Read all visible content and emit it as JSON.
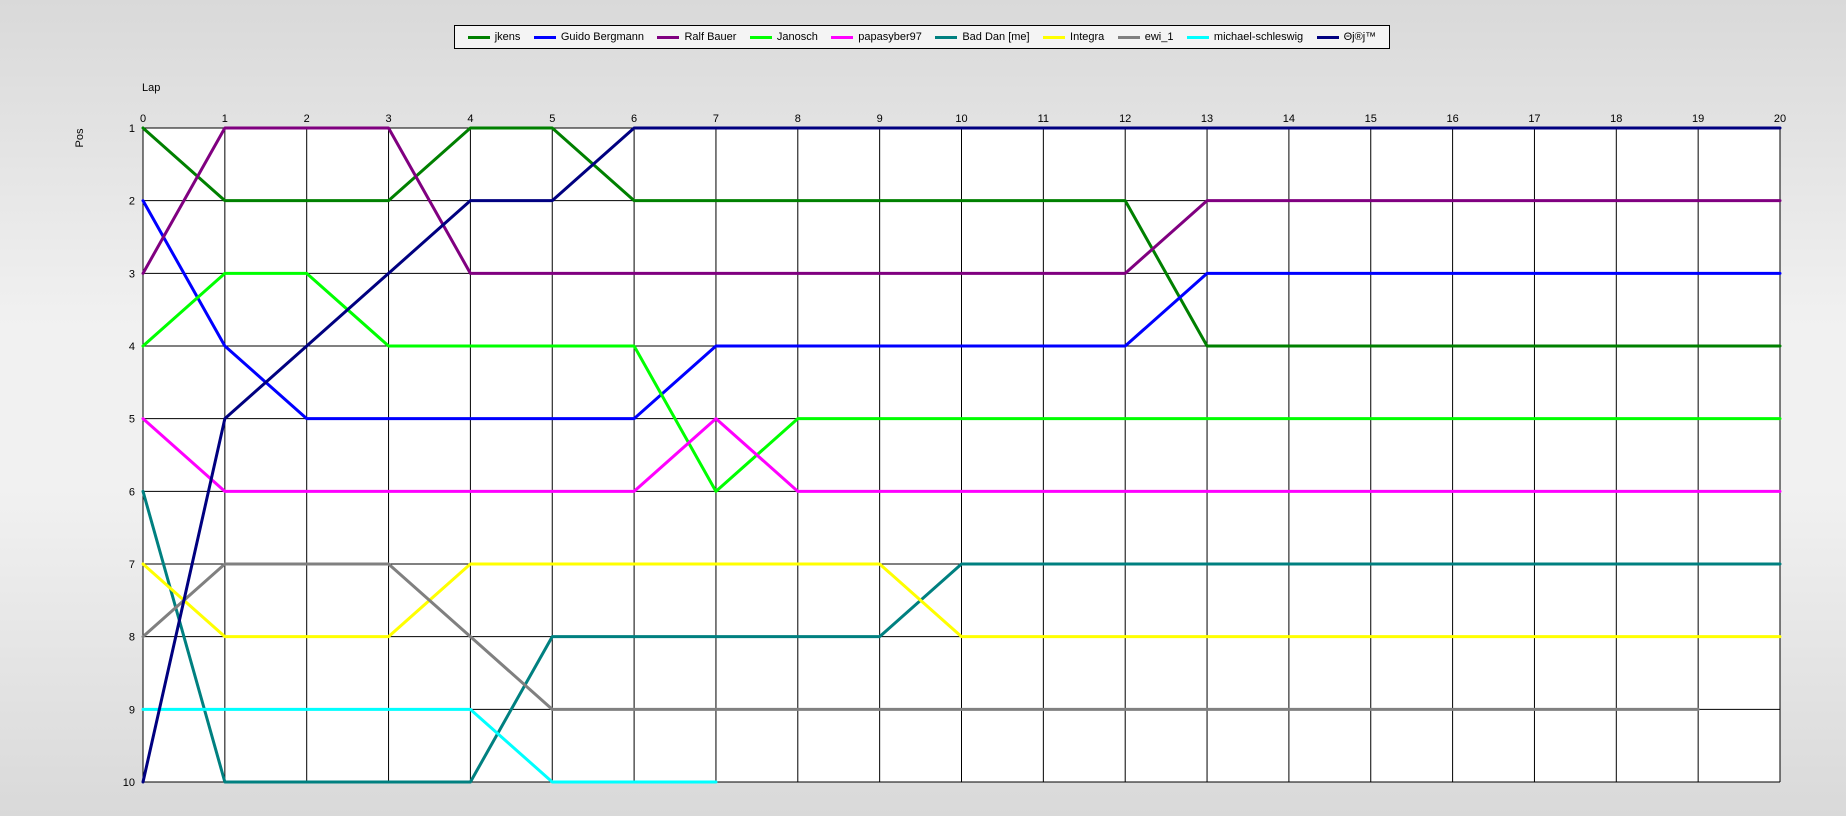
{
  "chart_data": {
    "type": "line",
    "xlabel": "Lap",
    "ylabel": "Pos",
    "xlim": [
      0,
      20
    ],
    "ylim": [
      1,
      10
    ],
    "y_inverted": true,
    "grid": true,
    "legend_placement": "top",
    "x_ticks": [
      "0",
      "1",
      "2",
      "3",
      "4",
      "5",
      "6",
      "7",
      "8",
      "9",
      "10",
      "11",
      "12",
      "13",
      "14",
      "15",
      "16",
      "17",
      "18",
      "19",
      "20"
    ],
    "y_ticks": [
      "1",
      "2",
      "3",
      "4",
      "5",
      "6",
      "7",
      "8",
      "9",
      "10"
    ],
    "series": [
      {
        "name": "jkens",
        "color": "#008000",
        "values": [
          1,
          2,
          2,
          2,
          1,
          1,
          2,
          2,
          2,
          2,
          2,
          2,
          2,
          4,
          4,
          4,
          4,
          4,
          4,
          4,
          4
        ]
      },
      {
        "name": "Guido Bergmann",
        "color": "#0000ff",
        "values": [
          2,
          4,
          5,
          5,
          5,
          5,
          5,
          4,
          4,
          4,
          4,
          4,
          4,
          3,
          3,
          3,
          3,
          3,
          3,
          3,
          3
        ]
      },
      {
        "name": "Ralf Bauer",
        "color": "#800080",
        "values": [
          3,
          1,
          1,
          1,
          3,
          3,
          3,
          3,
          3,
          3,
          3,
          3,
          3,
          2,
          2,
          2,
          2,
          2,
          2,
          2,
          2
        ]
      },
      {
        "name": "Janosch",
        "color": "#00ff00",
        "values": [
          4,
          3,
          3,
          4,
          4,
          4,
          4,
          6,
          5,
          5,
          5,
          5,
          5,
          5,
          5,
          5,
          5,
          5,
          5,
          5,
          5
        ]
      },
      {
        "name": "papasyber97",
        "color": "#ff00ff",
        "values": [
          5,
          6,
          6,
          6,
          6,
          6,
          6,
          5,
          6,
          6,
          6,
          6,
          6,
          6,
          6,
          6,
          6,
          6,
          6,
          6,
          6
        ]
      },
      {
        "name": "Bad Dan [me]",
        "color": "#008080",
        "values": [
          6,
          10,
          10,
          10,
          10,
          8,
          8,
          8,
          8,
          8,
          7,
          7,
          7,
          7,
          7,
          7,
          7,
          7,
          7,
          7,
          7
        ]
      },
      {
        "name": "Integra",
        "color": "#ffff00",
        "values": [
          7,
          8,
          8,
          8,
          7,
          7,
          7,
          7,
          7,
          7,
          8,
          8,
          8,
          8,
          8,
          8,
          8,
          8,
          8,
          8,
          8
        ]
      },
      {
        "name": "ewi_1",
        "color": "#808080",
        "values": [
          8,
          7,
          7,
          7,
          8,
          9,
          9,
          9,
          9,
          9,
          9,
          9,
          9,
          9,
          9,
          9,
          9,
          9,
          9,
          9
        ]
      },
      {
        "name": "michael-schleswig",
        "color": "#00ffff",
        "values": [
          9,
          9,
          9,
          9,
          9,
          10,
          10,
          10
        ]
      },
      {
        "name": "Θj®j™",
        "color": "#000080",
        "values": [
          10,
          5,
          4,
          3,
          2,
          2,
          1,
          1,
          1,
          1,
          1,
          1,
          1,
          1,
          1,
          1,
          1,
          1,
          1,
          1,
          1
        ]
      }
    ]
  }
}
